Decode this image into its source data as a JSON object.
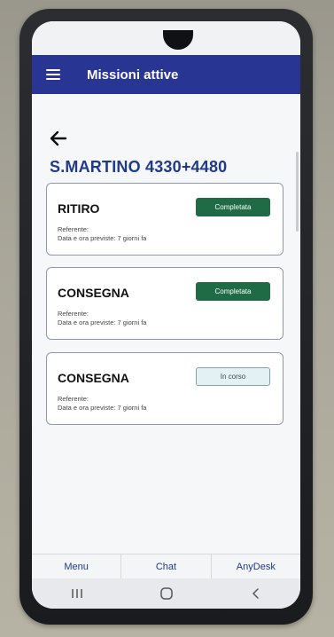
{
  "app": {
    "title": "Missioni attive"
  },
  "header": {
    "menu_icon": "hamburger-icon",
    "back_icon": "arrow-left-icon"
  },
  "site": {
    "title": "S.MARTINO 4330+4480"
  },
  "missions": [
    {
      "type": "RITIRO",
      "status": "Completata",
      "status_kind": "done",
      "referent": "Referente:",
      "date": "Data e ora previste: 7 giorni fa"
    },
    {
      "type": "CONSEGNA",
      "status": "Completata",
      "status_kind": "done",
      "referent": "Referente:",
      "date": "Data e ora previste: 7 giorni fa"
    },
    {
      "type": "CONSEGNA",
      "status": "In corso",
      "status_kind": "progress",
      "referent": "Referente:",
      "date": "Data e ora previste: 7 giorni fa"
    }
  ],
  "bottom_nav": [
    {
      "label": "Menu"
    },
    {
      "label": "Chat"
    },
    {
      "label": "AnyDesk"
    }
  ],
  "system_nav": [
    "recents-icon",
    "home-icon",
    "back-icon"
  ],
  "colors": {
    "appbar": "#283593",
    "completed": "#1e6b45",
    "in_progress": "#e3f1f4",
    "title": "#1f3a8a"
  }
}
